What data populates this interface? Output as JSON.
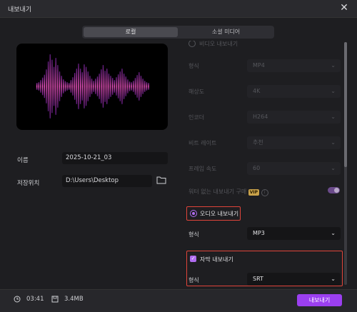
{
  "window": {
    "title": "내보내기",
    "close_icon": "close-icon"
  },
  "tabs": [
    {
      "label": "로컬"
    },
    {
      "label": "소셜 미디어"
    }
  ],
  "left": {
    "name_label": "이름",
    "name_value": "2025-10-21_03",
    "path_label": "저장위치",
    "path_value": "D:\\Users\\Desktop"
  },
  "settings": {
    "video_export_label": "비디오 내보내기",
    "format_label": "형식",
    "format_value": "MP4",
    "resolution_label": "해상도",
    "resolution_value": "4K",
    "encoder_label": "인코더",
    "encoder_value": "H264",
    "bitrate_label": "비트 레이트",
    "bitrate_value": "추천",
    "framerate_label": "프레임 속도",
    "framerate_value": "60",
    "watermark_label": "워터 없는 내보내기 구매",
    "vip_badge": "VIP",
    "audio_export_label": "오디오 내보내기",
    "audio_format_label": "형식",
    "audio_format_value": "MP3",
    "subtitle_export_label": "자막 내보내기",
    "subtitle_format_label": "형식",
    "subtitle_format_value": "SRT"
  },
  "footer": {
    "duration": "03:41",
    "size": "3.4MB",
    "export_button": "내보내기"
  },
  "colors": {
    "accent": "#9b3ff0",
    "highlight": "#e0443a",
    "wave_top": "#ff5ad0",
    "wave_bottom": "#5a1a7a"
  },
  "waveform_levels": [
    0.1,
    0.12,
    0.18,
    0.25,
    0.33,
    0.48,
    0.7,
    0.9,
    0.75,
    0.55,
    0.8,
    0.6,
    0.42,
    0.3,
    0.2,
    0.15,
    0.12,
    0.1,
    0.18,
    0.26,
    0.38,
    0.5,
    0.64,
    0.5,
    0.4,
    0.62,
    0.55,
    0.42,
    0.3,
    0.22,
    0.16,
    0.22,
    0.28,
    0.36,
    0.48,
    0.6,
    0.44,
    0.5,
    0.36,
    0.3,
    0.24,
    0.18,
    0.26,
    0.34,
    0.42,
    0.5,
    0.36,
    0.28,
    0.2,
    0.14,
    0.12,
    0.16,
    0.24,
    0.32,
    0.4,
    0.3,
    0.22,
    0.16,
    0.12,
    0.1
  ]
}
